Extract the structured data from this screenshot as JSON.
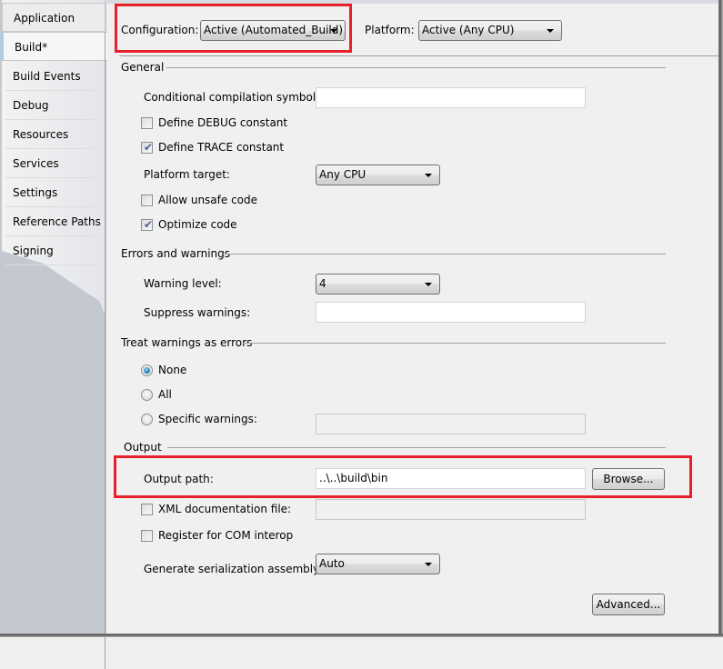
{
  "tabs": [
    {
      "label": "Application",
      "active": false
    },
    {
      "label": "Build*",
      "active": true
    },
    {
      "label": "Build Events",
      "active": false
    },
    {
      "label": "Debug",
      "active": false
    },
    {
      "label": "Resources",
      "active": false
    },
    {
      "label": "Services",
      "active": false
    },
    {
      "label": "Settings",
      "active": false
    },
    {
      "label": "Reference Paths",
      "active": false
    },
    {
      "label": "Signing",
      "active": false
    }
  ],
  "header": {
    "configuration_label": "Configuration:",
    "configuration_value": "Active (Automated_Build)",
    "platform_label": "Platform:",
    "platform_value": "Active (Any CPU)"
  },
  "general": {
    "title": "General",
    "conditional_symbols_label": "Conditional compilation symbols:",
    "conditional_symbols_value": "",
    "define_debug_label": "Define DEBUG constant",
    "define_debug_checked": false,
    "define_trace_label": "Define TRACE constant",
    "define_trace_checked": true,
    "platform_target_label": "Platform target:",
    "platform_target_value": "Any CPU",
    "allow_unsafe_label": "Allow unsafe code",
    "allow_unsafe_checked": false,
    "optimize_label": "Optimize code",
    "optimize_checked": true
  },
  "errors": {
    "title": "Errors and warnings",
    "warning_level_label": "Warning level:",
    "warning_level_value": "4",
    "suppress_label": "Suppress warnings:",
    "suppress_value": ""
  },
  "treat": {
    "title": "Treat warnings as errors",
    "options": [
      {
        "label": "None",
        "selected": true
      },
      {
        "label": "All",
        "selected": false
      },
      {
        "label": "Specific warnings:",
        "selected": false
      }
    ],
    "specific_value": ""
  },
  "output": {
    "title": "Output",
    "path_label": "Output path:",
    "path_value": "..\\..\\build\\bin",
    "browse_label": "Browse...",
    "xml_doc_label": "XML documentation file:",
    "xml_doc_checked": false,
    "xml_doc_value": "",
    "com_interop_label": "Register for COM interop",
    "com_interop_checked": false,
    "serialization_label": "Generate serialization assembly:",
    "serialization_value": "Auto",
    "advanced_label": "Advanced..."
  },
  "icons": {
    "check_glyph": "✔",
    "dropdown": "triangle-down"
  },
  "colors": {
    "highlight_red": "#e8202a",
    "radio_selected": "#1a6fb0",
    "checkmark": "#4a5f97"
  }
}
